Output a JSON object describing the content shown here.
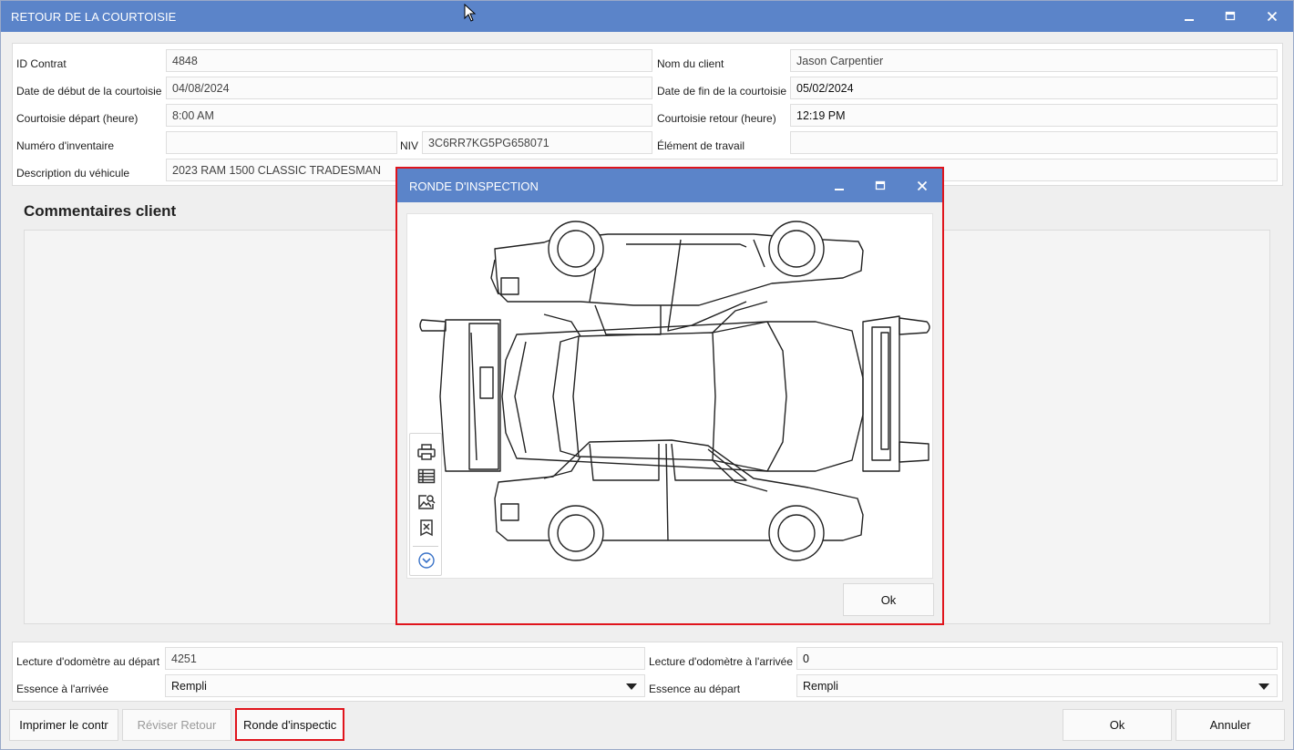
{
  "window": {
    "title": "RETOUR DE LA COURTOISIE",
    "accent_color": "#5b84c9"
  },
  "info": {
    "contract_id": {
      "label": "ID Contrat",
      "value": "4848"
    },
    "client_name": {
      "label": "Nom du client",
      "value": "Jason Carpentier"
    },
    "start_date": {
      "label": "Date de début de la courtoisie",
      "value": "04/08/2024"
    },
    "end_date": {
      "label": "Date de fin de la courtoisie",
      "value": "05/02/2024"
    },
    "departure_time": {
      "label": "Courtoisie départ (heure)",
      "value": "8:00 AM"
    },
    "return_time": {
      "label": "Courtoisie retour (heure)",
      "value": "12:19 PM"
    },
    "inventory_number": {
      "label": "Numéro d'inventaire",
      "value": ""
    },
    "vin": {
      "label": "NIV",
      "value": "3C6RR7KG5PG658071"
    },
    "work_item": {
      "label": "Élément de travail",
      "value": ""
    },
    "vehicle_description": {
      "label": "Description du véhicule",
      "value": "2023 RAM 1500 CLASSIC TRADESMAN"
    }
  },
  "comments": {
    "title": "Commentaires client"
  },
  "bottom": {
    "odometer_departure": {
      "label": "Lecture d'odomètre au départ",
      "value": "4251"
    },
    "odometer_arrival": {
      "label": "Lecture d'odomètre à l'arrivée",
      "value": "0"
    },
    "fuel_arrival": {
      "label": "Essence à l'arrivée",
      "value": "Rempli"
    },
    "fuel_departure": {
      "label": "Essence au départ",
      "value": "Rempli"
    }
  },
  "buttons": {
    "print": "Imprimer le contr",
    "revise_return": "Réviser Retour",
    "inspection_round": "Ronde d'inspectic",
    "ok": "Ok",
    "cancel": "Annuler"
  },
  "dialog": {
    "title": "RONDE D'INSPECTION",
    "ok": "Ok",
    "highlight_color": "#e0141c",
    "tools": [
      "printer-icon",
      "table-view-icon",
      "image-search-icon",
      "clear-bookmark-icon",
      "expand-more-icon"
    ]
  }
}
